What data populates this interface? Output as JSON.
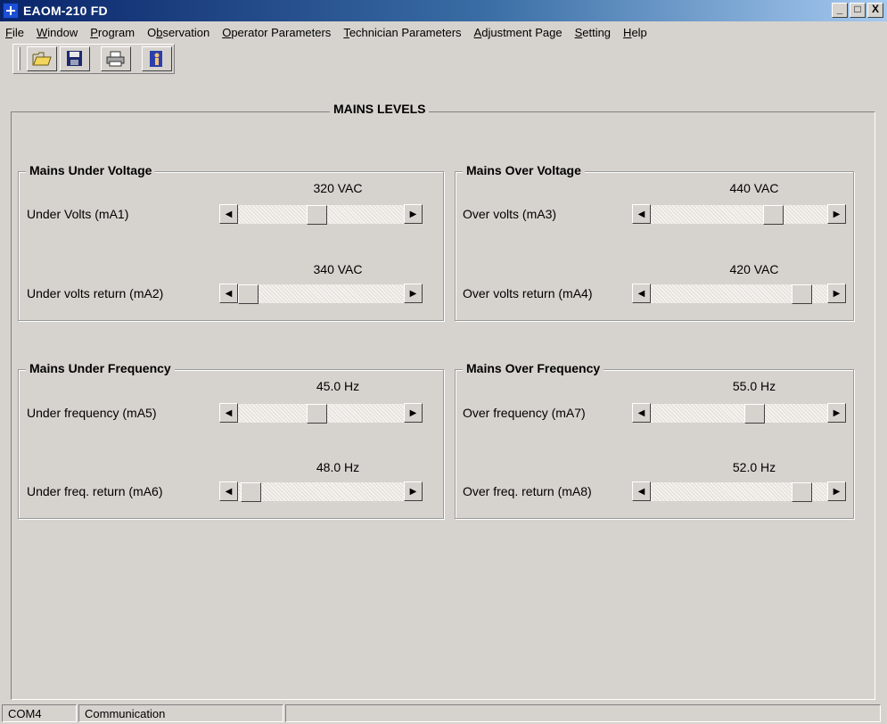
{
  "window": {
    "title": "EAOM-210 FD",
    "controls": [
      "_",
      "□",
      "X"
    ]
  },
  "menu": [
    {
      "label": "File",
      "u": "F",
      "rest": "ile"
    },
    {
      "label": "Window",
      "u": "W",
      "rest": "indow"
    },
    {
      "label": "Program",
      "u": "P",
      "rest": "rogram"
    },
    {
      "label": "Observation",
      "pre": "O",
      "u": "b",
      "rest": "servation"
    },
    {
      "label": "Operator Parameters",
      "u": "O",
      "rest": "perator Parameters"
    },
    {
      "label": "Technician Parameters",
      "u": "T",
      "rest": "echnician Parameters"
    },
    {
      "label": "Adjustment Page",
      "u": "A",
      "rest": "djustment Page"
    },
    {
      "label": "Setting",
      "u": "S",
      "rest": "etting"
    },
    {
      "label": "Help",
      "u": "H",
      "rest": "elp"
    }
  ],
  "toolbar": {
    "buttons": [
      {
        "name": "open-folder",
        "icon": "folder-open-icon"
      },
      {
        "name": "save",
        "icon": "floppy-disk-icon"
      },
      {
        "name": "print",
        "icon": "printer-icon"
      },
      {
        "name": "exit",
        "icon": "exit-door-icon"
      }
    ]
  },
  "panel_title": "MAINS LEVELS",
  "groups": [
    {
      "title": "Mains Under Voltage",
      "rows": [
        {
          "label": "Under Volts (mA1)",
          "value": "320 VAC",
          "level": 0.47
        },
        {
          "label": "Under volts return (mA2)",
          "value": "340 VAC",
          "level": 0.0
        }
      ]
    },
    {
      "title": "Mains Over Voltage",
      "rows": [
        {
          "label": "Over volts (mA3)",
          "value": "440 VAC",
          "level": 0.72
        },
        {
          "label": "Over volts return (mA4)",
          "value": "420 VAC",
          "level": 0.9
        }
      ]
    },
    {
      "title": "Mains Under Frequency",
      "rows": [
        {
          "label": "Under frequency (mA5)",
          "value": "45.0 Hz",
          "level": 0.47
        },
        {
          "label": "Under freq. return (mA6)",
          "value": "48.0 Hz",
          "level": 0.02
        }
      ]
    },
    {
      "title": "Mains Over Frequency",
      "rows": [
        {
          "label": "Over frequency (mA7)",
          "value": "55.0 Hz",
          "level": 0.6
        },
        {
          "label": "Over freq. return (mA8)",
          "value": "52.0 Hz",
          "level": 0.9
        }
      ]
    }
  ],
  "status": {
    "port": "COM4",
    "state": "Communication",
    "extra": ""
  }
}
